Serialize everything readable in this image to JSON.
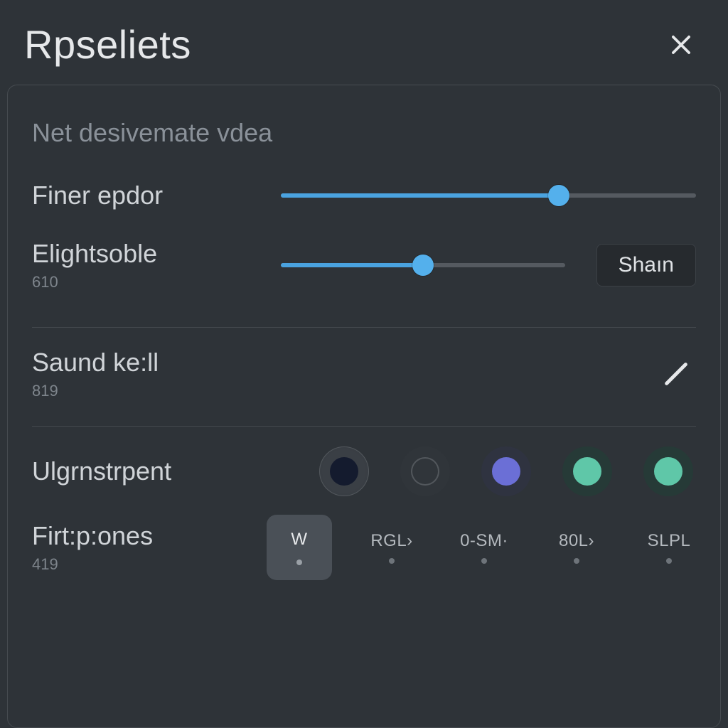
{
  "header": {
    "title": "Rpseliets"
  },
  "panel": {
    "subtitle": "Net desivemate vdea",
    "sliders": [
      {
        "label": "Finer epdor",
        "sub": "",
        "percent": 67,
        "trail": true
      },
      {
        "label": "Elightsoble",
        "sub": "610",
        "percent": 50,
        "trail": false,
        "button": "Shaın"
      }
    ],
    "editRow": {
      "label": "Saund ke:ll",
      "sub": "819"
    },
    "swatchRow": {
      "label": "Ulgrnstrpent",
      "swatches": [
        {
          "name": "swatch-navy",
          "bg": "#3a3f45",
          "inner": "#141b2e",
          "selected": true
        },
        {
          "name": "swatch-hollow",
          "bg": "#30353a",
          "inner": "transparent",
          "ring": "#52575c"
        },
        {
          "name": "swatch-violet",
          "bg": "#2f3340",
          "inner": "#6b6fd6"
        },
        {
          "name": "swatch-teal-1",
          "bg": "#263a37",
          "inner": "#5fc7a8"
        },
        {
          "name": "swatch-teal-2",
          "bg": "#263a37",
          "inner": "#5fc7a8"
        }
      ]
    },
    "optionRow": {
      "label": "Firt:p:ones",
      "sub": "419",
      "options": [
        {
          "code": "W",
          "selected": true
        },
        {
          "code": "RGL›"
        },
        {
          "code": "0-SM·"
        },
        {
          "code": "80L›"
        },
        {
          "code": "SLPL"
        }
      ]
    }
  },
  "colors": {
    "accent": "#4aa3e0"
  }
}
